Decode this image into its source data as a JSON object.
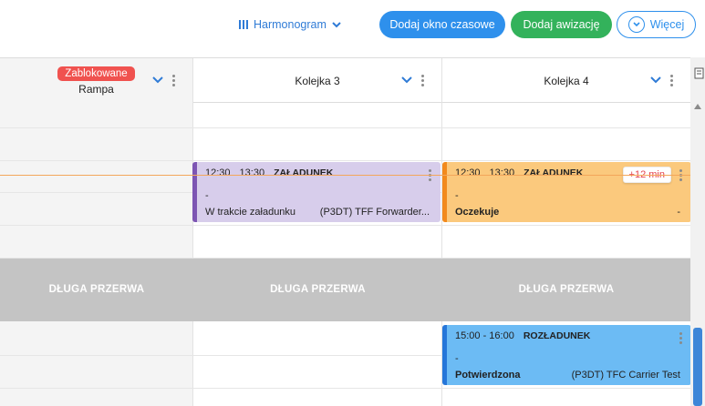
{
  "toolbar": {
    "view_switch_label": "Harmonogram",
    "add_window_label": "Dodaj okno czasowe",
    "add_notice_label": "Dodaj awizację",
    "more_label": "Więcej"
  },
  "columns": [
    {
      "badge": "Zablokowane",
      "name": "Rampa"
    },
    {
      "name": "Kolejka 3"
    },
    {
      "name": "Kolejka 4"
    }
  ],
  "break_label": "DŁUGA PRZERWA",
  "events": [
    {
      "time_start": "12:30",
      "time_end": "13:30",
      "type": "ZAŁADUNEK",
      "dash": "-",
      "status": "W trakcie załadunku",
      "carrier": "(P3DT) TFF Forwarder..."
    },
    {
      "time_start": "12:30",
      "time_end": "13:30",
      "type": "ZAŁADUNEK",
      "dash": "-",
      "status": "Oczekuje",
      "carrier": "-",
      "late": "+12 min"
    },
    {
      "time_range": "15:00 - 16:00",
      "type": "ROZŁADUNEK",
      "dash": "-",
      "status": "Potwierdzona",
      "carrier": "(P3DT) TFC Carrier Test"
    }
  ],
  "colors": {
    "primary_blue": "#2e90ec",
    "green": "#33b25b",
    "blocked_red": "#f0524f",
    "loading_purple": "#d7cdeb",
    "waiting_orange": "#fbc97d",
    "confirmed_blue": "#6cbbf4",
    "break_gray": "#c4c4c4",
    "now_line": "#f3a65a"
  }
}
